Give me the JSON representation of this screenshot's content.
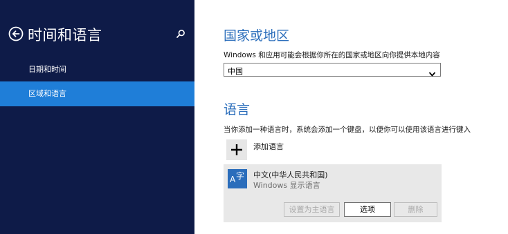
{
  "sidebar": {
    "title": "时间和语言",
    "items": [
      {
        "label": "日期和时间",
        "selected": false
      },
      {
        "label": "区域和语言",
        "selected": true
      }
    ],
    "icons": {
      "back": "back-arrow-icon",
      "search": "search-icon"
    },
    "colors": {
      "background": "#0e1b48",
      "selected": "#1f7ed8"
    }
  },
  "region": {
    "heading": "国家或地区",
    "description": "Windows 和应用可能会根据你所在的国家或地区向你提供本地内容",
    "selected_value": "中国"
  },
  "language": {
    "heading": "语言",
    "description": "当你添加一种语言时，系统会添加一个键盘，以便你可以使用该语言进行键入",
    "add_label": "添加语言",
    "installed": [
      {
        "name": "中文(中华人民共和国)",
        "subtitle": "Windows 显示语言",
        "tile_glyphs": {
          "latin": "A",
          "cjk": "字"
        },
        "buttons": {
          "set_primary": "设置为主语言",
          "options": "选项",
          "remove": "删除"
        }
      }
    ]
  },
  "colors": {
    "accent": "#2a6dbb"
  }
}
